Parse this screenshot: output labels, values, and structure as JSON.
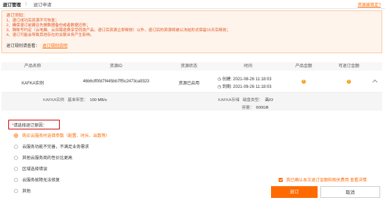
{
  "breadcrumb": {
    "main": "退订管理",
    "sep": "〉",
    "current": "退订申请"
  },
  "help_link": "资源被锁定?",
  "notice": {
    "title": "退订须知：",
    "lines": [
      "1、退订成功后资源不可恢复；",
      "2、确保退订前建议先做数据备份或者数据迁移；",
      "3、跨账号约定（云电脑、云间需退费享受同类产品，退订后资源立即释放）以外，退订后的资源将被以冻结形式保留15天后释放；",
      "4、退订可能会导致其他存在的关联业务产生影响。"
    ],
    "read_label": "退订规则请查看：",
    "read_link": "退订规则说明"
  },
  "table": {
    "headers": [
      "产品名称",
      "资源ID",
      "资源状态",
      "时间",
      "产品金额",
      "可退订金额"
    ],
    "row": {
      "product": "KAFKA实例",
      "resource_id": "46b6cff0fd7f445bb7ff5c2473ca9323",
      "status": "资源已启用",
      "created_label": "创建:",
      "created": "2021-08-26 11:18:03",
      "expires_label": "到期:",
      "expires": "2021-09-26 11:18:03"
    },
    "detail": {
      "instance_label": "KAFKA实例",
      "bandwidth_label": "基准带宽：",
      "bandwidth": "100 MB/s",
      "storage_label": "KAFKA存储",
      "disk_type_label": "磁盘类型：",
      "disk_type": "高IO",
      "capacity_label": "容量：",
      "capacity": "600GB"
    }
  },
  "reason": {
    "required_mark": "*",
    "title": "请选择退订原因：",
    "options": [
      "购买云服务时选错参数（配置、时长、出数等）",
      "云服务功能不完善，不满足业务需求",
      "其他云服务商的性价比更高",
      "区域选择错误",
      "云服务故障无法修复",
      "其他"
    ],
    "selected_index": 0
  },
  "confirm_text": "我已确认本次退订金额和相关费用 查看详情",
  "buttons": {
    "ok": "退订",
    "cancel": "取消"
  },
  "colors": {
    "accent": "#ff6a00",
    "notice_text": "#e0531f",
    "warning_dot": "#f2a11a"
  }
}
